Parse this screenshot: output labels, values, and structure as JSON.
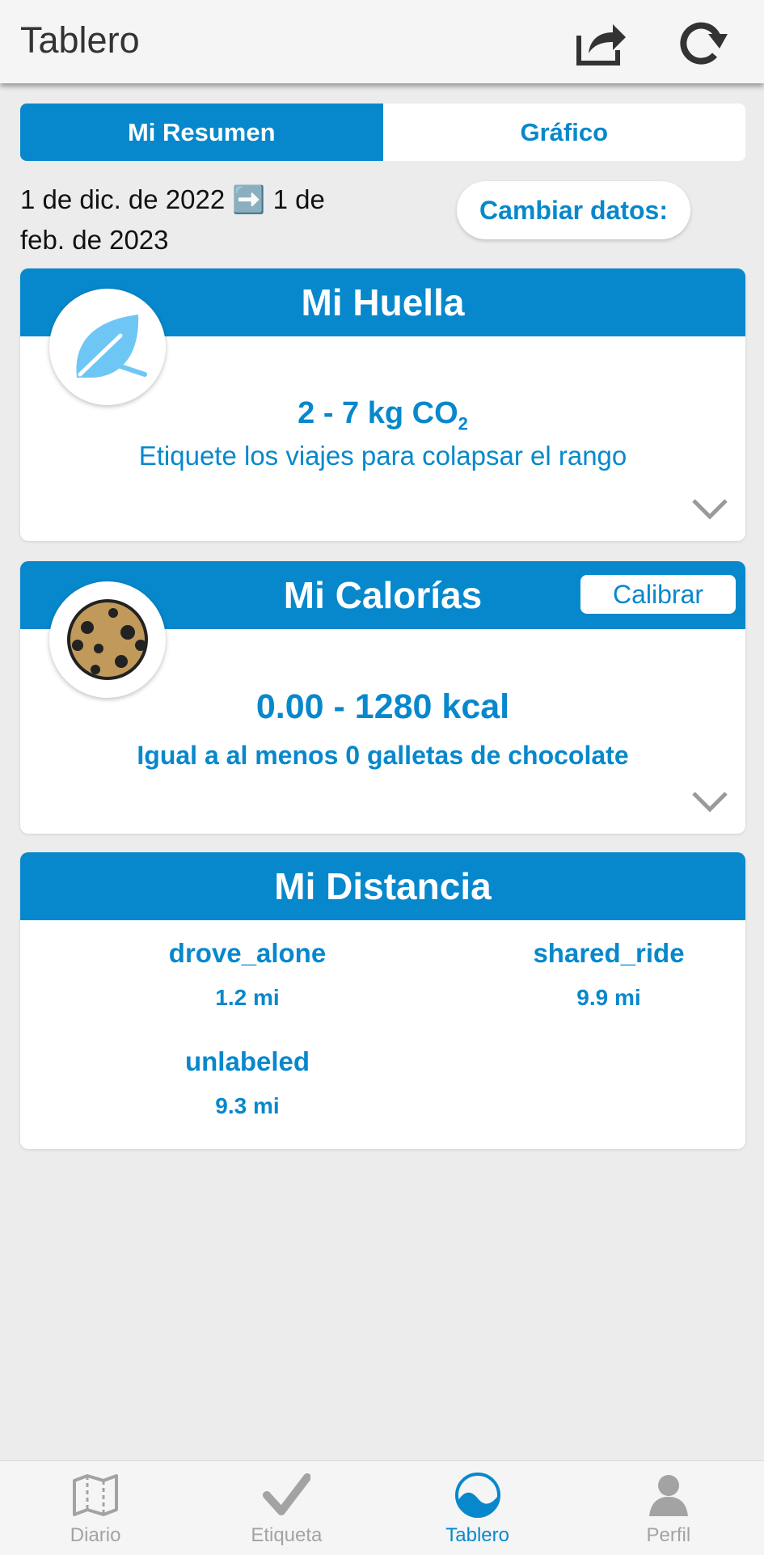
{
  "header": {
    "title": "Tablero"
  },
  "tabs": [
    {
      "label": "Mi Resumen",
      "active": true
    },
    {
      "label": "Gráfico",
      "active": false
    }
  ],
  "date_range": {
    "text": "1 de dic. de 2022 ➡️ 1 de feb. de 2023"
  },
  "change_data_label": "Cambiar datos:",
  "footprint": {
    "title": "Mi Huella",
    "value": "2 - 7 kg CO",
    "value_sub": "2",
    "hint": "Etiquete los viajes para colapsar el rango",
    "icon": "leaf-icon"
  },
  "calories": {
    "title": "Mi Calorías",
    "calibrate_label": "Calibrar",
    "value": "0.00 - 1280 kcal",
    "hint": "Igual a al menos 0 galletas de chocolate",
    "icon": "cookie-icon"
  },
  "distance": {
    "title": "Mi Distancia",
    "items": [
      {
        "mode": "drove_alone",
        "value": "1.2 mi"
      },
      {
        "mode": "shared_ride",
        "value": "9.9 mi"
      },
      {
        "mode": "unlabeled",
        "value": "9.3 mi"
      }
    ]
  },
  "nav": [
    {
      "label": "Diario",
      "icon": "map-icon",
      "active": false
    },
    {
      "label": "Etiqueta",
      "icon": "checkmark-icon",
      "active": false
    },
    {
      "label": "Tablero",
      "icon": "dashboard-icon",
      "active": true
    },
    {
      "label": "Perfil",
      "icon": "person-icon",
      "active": false
    }
  ],
  "colors": {
    "accent": "#0788cc",
    "background": "#ececec",
    "inactive_nav": "#a3a3a3",
    "leaf": "#6ec6f5",
    "cookie": "#c19a5b"
  }
}
